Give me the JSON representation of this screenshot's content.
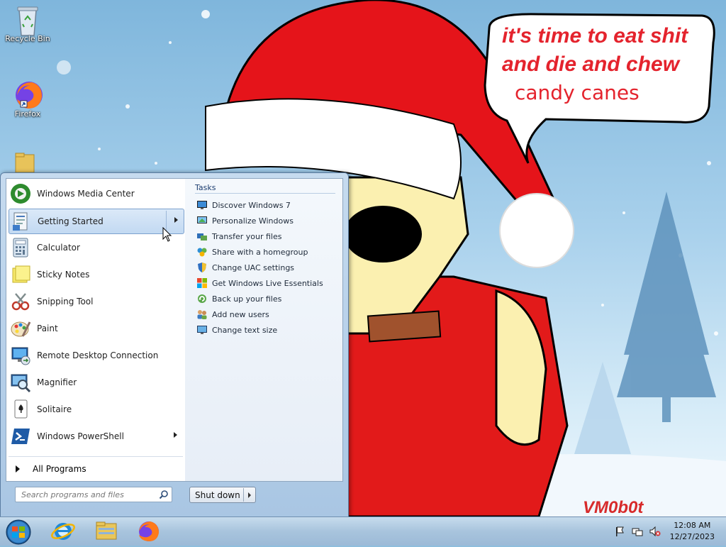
{
  "desktop": {
    "icons": [
      {
        "label": "Recycle Bin",
        "icon": "recycle-bin-icon"
      },
      {
        "label": "Firefox",
        "icon": "firefox-icon"
      }
    ],
    "wallpaper": {
      "speech_lines": [
        "it's time to eat shit",
        "and die and chew",
        "candy canes"
      ],
      "signature": "VM0b0t"
    }
  },
  "start_menu": {
    "programs": [
      {
        "label": "Windows Media Center",
        "icon": "media-center-icon"
      },
      {
        "label": "Getting Started",
        "icon": "getting-started-icon",
        "highlighted": true,
        "submenu": true
      },
      {
        "label": "Calculator",
        "icon": "calculator-icon"
      },
      {
        "label": "Sticky Notes",
        "icon": "sticky-notes-icon"
      },
      {
        "label": "Snipping Tool",
        "icon": "snipping-tool-icon"
      },
      {
        "label": "Paint",
        "icon": "paint-icon"
      },
      {
        "label": "Remote Desktop Connection",
        "icon": "remote-desktop-icon"
      },
      {
        "label": "Magnifier",
        "icon": "magnifier-icon"
      },
      {
        "label": "Solitaire",
        "icon": "solitaire-icon"
      },
      {
        "label": "Windows PowerShell",
        "icon": "powershell-icon",
        "submenu": true
      }
    ],
    "all_programs": "All Programs",
    "tasks_title": "Tasks",
    "tasks": [
      "Discover Windows 7",
      "Personalize Windows",
      "Transfer your files",
      "Share with a homegroup",
      "Change UAC settings",
      "Get Windows Live Essentials",
      "Back up your files",
      "Add new users",
      "Change text size"
    ],
    "search_placeholder": "Search programs and files",
    "shutdown_label": "Shut down"
  },
  "taskbar": {
    "pinned": [
      "start-orb-icon",
      "internet-explorer-icon",
      "file-explorer-icon",
      "firefox-icon"
    ],
    "clock_time": "12:08 AM",
    "clock_date": "12/27/2023"
  }
}
